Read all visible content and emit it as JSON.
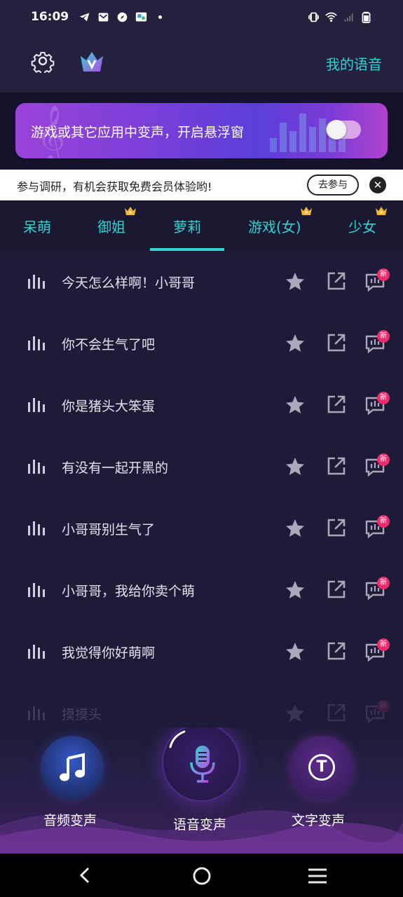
{
  "status_bar": {
    "time": "16:09",
    "left_icons": [
      "telegram-icon",
      "mail-icon",
      "compass-icon",
      "app-icon",
      "dot-icon"
    ],
    "right_icons": [
      "vibrate-icon",
      "wifi-icon",
      "signal-icon",
      "battery-icon"
    ]
  },
  "header": {
    "settings_icon": "gear-icon",
    "logo_icon": "crown-v-logo-icon",
    "my_voice_label": "我的语音"
  },
  "banner": {
    "text": "游戏或其它应用中变声，开启悬浮窗",
    "toggle_on": false
  },
  "survey": {
    "text": "参与调研，有机会获取免费会员体验哟!",
    "join_label": "去参与",
    "close_label": "✕"
  },
  "tabs": [
    {
      "label": "呆萌",
      "vip": false,
      "active": false
    },
    {
      "label": "御姐",
      "vip": true,
      "active": false
    },
    {
      "label": "萝莉",
      "vip": false,
      "active": true
    },
    {
      "label": "游戏(女)",
      "vip": true,
      "active": false
    },
    {
      "label": "少女",
      "vip": true,
      "active": false
    }
  ],
  "voice_list": [
    {
      "text": "今天怎么样啊！小哥哥",
      "new_badge": "新"
    },
    {
      "text": "你不会生气了吧",
      "new_badge": "新"
    },
    {
      "text": "你是猪头大笨蛋",
      "new_badge": "新"
    },
    {
      "text": "有没有一起开黑的",
      "new_badge": "新"
    },
    {
      "text": "小哥哥别生气了",
      "new_badge": "新"
    },
    {
      "text": "小哥哥，我给你卖个萌",
      "new_badge": "新"
    },
    {
      "text": "我觉得你好萌啊",
      "new_badge": "新"
    },
    {
      "text": "摸摸头",
      "new_badge": "新"
    }
  ],
  "bottom_nav": {
    "audio_label": "音频变声",
    "voice_label": "语音变声",
    "text_label": "文字变声",
    "text_circle_letter": "T"
  },
  "colors": {
    "accent": "#2fd4d0",
    "background": "#1e1b38",
    "new_badge": "#ee2a6a"
  }
}
